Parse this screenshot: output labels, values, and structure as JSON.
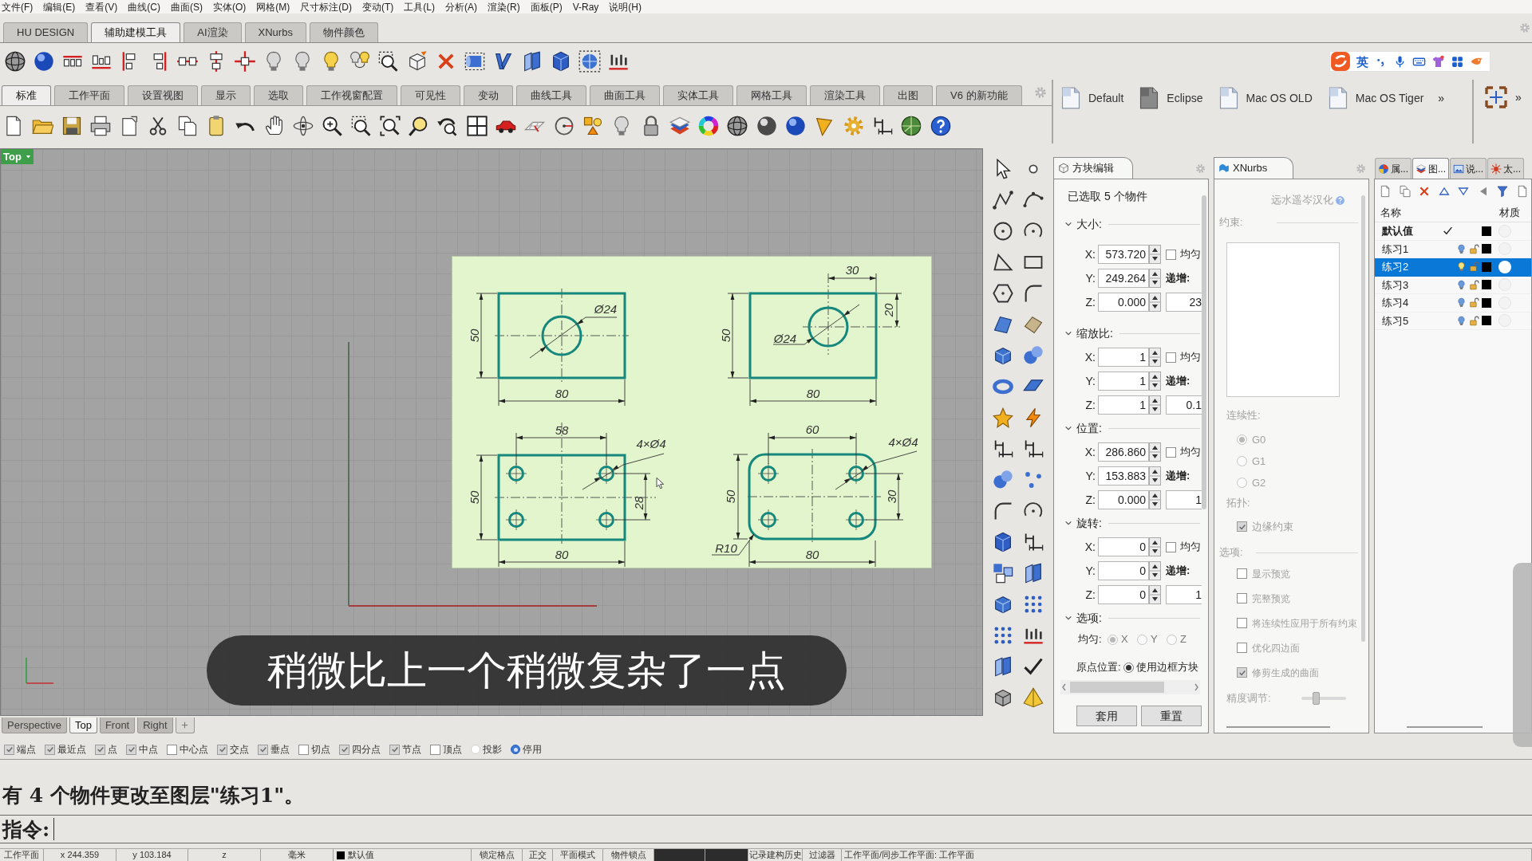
{
  "menu": [
    "文件(F)",
    "编辑(E)",
    "查看(V)",
    "曲线(C)",
    "曲面(S)",
    "实体(O)",
    "网格(M)",
    "尺寸标注(D)",
    "变动(T)",
    "工具(L)",
    "分析(A)",
    "渲染(R)",
    "面板(P)",
    "V-Ray",
    "说明(H)"
  ],
  "ribbon_tabs": [
    {
      "label": "HU DESIGN",
      "selected": false
    },
    {
      "label": "辅助建模工具",
      "selected": true
    },
    {
      "label": "AI渲染",
      "selected": false
    },
    {
      "label": "XNurbs",
      "selected": false
    },
    {
      "label": "物件颜色",
      "selected": false
    }
  ],
  "ime_bar": {
    "mode": "英"
  },
  "toolbar_tabs": [
    {
      "label": "标准",
      "selected": true
    },
    {
      "label": "工作平面",
      "selected": false
    },
    {
      "label": "设置视图",
      "selected": false
    },
    {
      "label": "显示",
      "selected": false
    },
    {
      "label": "选取",
      "selected": false
    },
    {
      "label": "工作视窗配置",
      "selected": false
    },
    {
      "label": "可见性",
      "selected": false
    },
    {
      "label": "变动",
      "selected": false
    },
    {
      "label": "曲线工具",
      "selected": false
    },
    {
      "label": "曲面工具",
      "selected": false
    },
    {
      "label": "实体工具",
      "selected": false
    },
    {
      "label": "网格工具",
      "selected": false
    },
    {
      "label": "渲染工具",
      "selected": false
    },
    {
      "label": "出图",
      "selected": false
    },
    {
      "label": "V6 的新功能",
      "selected": false
    }
  ],
  "skins": {
    "items": [
      {
        "label": "Default",
        "kind": "light"
      },
      {
        "label": "Eclipse",
        "kind": "dark"
      },
      {
        "label": "Mac OS OLD",
        "kind": "light"
      },
      {
        "label": "Mac OS Tiger",
        "kind": "light"
      }
    ],
    "more": "»"
  },
  "view_toolbar": {
    "more": "»"
  },
  "viewport": {
    "title": "Top",
    "subtitle": "稍微比上一个稍微复杂了一点",
    "tabs": [
      {
        "label": "Perspective",
        "selected": false
      },
      {
        "label": "Top",
        "selected": true
      },
      {
        "label": "Front",
        "selected": false
      },
      {
        "label": "Right",
        "selected": false
      }
    ]
  },
  "drawing": {
    "views": [
      {
        "kind": "centered-hole",
        "labels": [
          "50",
          "80",
          "Ø24"
        ]
      },
      {
        "kind": "offset-hole",
        "labels": [
          "30",
          "20",
          "50",
          "Ø24",
          "80"
        ]
      },
      {
        "kind": "four-holes",
        "labels": [
          "58",
          "4×Ø4",
          "50",
          "28",
          "80"
        ]
      },
      {
        "kind": "four-holes-rounded",
        "labels": [
          "60",
          "4×Ø4",
          "50",
          "30",
          "R10",
          "80"
        ]
      }
    ]
  },
  "block_edit": {
    "title": "方块编辑",
    "selection": "已选取 5 个物件",
    "sections": [
      {
        "title": "大小:",
        "expanded": true,
        "rows": [
          {
            "axis": "X:",
            "value": "573.720",
            "extra": {
              "kind": "checkbox",
              "label": "均匀",
              "checked": false
            }
          },
          {
            "axis": "Y:",
            "value": "249.264",
            "extra": {
              "kind": "label",
              "label": "递增:"
            }
          },
          {
            "axis": "Z:",
            "value": "0.000",
            "extra": {
              "kind": "field",
              "value": "23"
            }
          }
        ]
      },
      {
        "title": "缩放比:",
        "expanded": true,
        "rows": [
          {
            "axis": "X:",
            "value": "1",
            "extra": {
              "kind": "checkbox",
              "label": "均匀",
              "checked": false
            }
          },
          {
            "axis": "Y:",
            "value": "1",
            "extra": {
              "kind": "label",
              "label": "递增:"
            }
          },
          {
            "axis": "Z:",
            "value": "1",
            "extra": {
              "kind": "field",
              "value": "0.1"
            }
          }
        ]
      },
      {
        "title": "位置:",
        "expanded": true,
        "rows": [
          {
            "axis": "X:",
            "value": "286.860",
            "extra": {
              "kind": "checkbox",
              "label": "均匀",
              "checked": false
            }
          },
          {
            "axis": "Y:",
            "value": "153.883",
            "extra": {
              "kind": "label",
              "label": "递增:"
            }
          },
          {
            "axis": "Z:",
            "value": "0.000",
            "extra": {
              "kind": "field",
              "value": "1"
            }
          }
        ]
      },
      {
        "title": "旋转:",
        "expanded": true,
        "rows": [
          {
            "axis": "X:",
            "value": "0",
            "extra": {
              "kind": "checkbox",
              "label": "均匀",
              "checked": false
            }
          },
          {
            "axis": "Y:",
            "value": "0",
            "extra": {
              "kind": "label",
              "label": "递增:"
            }
          },
          {
            "axis": "Z:",
            "value": "0",
            "extra": {
              "kind": "field",
              "value": "1"
            }
          }
        ]
      }
    ],
    "options": {
      "title": "选项:",
      "expanded": true,
      "uniform_label": "均匀:",
      "uniform_axes": [
        {
          "label": "X",
          "selected": true
        },
        {
          "label": "Y",
          "selected": false
        },
        {
          "label": "Z",
          "selected": false
        }
      ],
      "origin_label": "原点位置:",
      "origin_choices": [
        {
          "label": "使用边框方块",
          "selected": true
        }
      ]
    },
    "buttons": [
      "套用",
      "重置"
    ]
  },
  "xnurbs": {
    "title": "XNurbs",
    "credit": "远水遥岑汉化",
    "constraints_label": "约束:",
    "continuity_label": "连续性:",
    "continuity": [
      {
        "label": "G0",
        "selected": true
      },
      {
        "label": "G1",
        "selected": false
      },
      {
        "label": "G2",
        "selected": false
      }
    ],
    "topology_label": "拓扑:",
    "topology": [
      {
        "label": "边缘约束",
        "checked": true
      }
    ],
    "options_label": "选项:",
    "options": [
      {
        "label": "显示预览",
        "checked": false
      },
      {
        "label": "完整预览",
        "checked": false
      },
      {
        "label": "将连续性应用于所有约束",
        "checked": false
      },
      {
        "label": "优化四边面",
        "checked": false
      },
      {
        "label": "修剪生成的曲面",
        "checked": true
      }
    ],
    "precision_label": "精度调节:",
    "precision": {
      "level": 0.3
    }
  },
  "layers": {
    "tabs": [
      {
        "label": "属...",
        "selected": false
      },
      {
        "label": "图...",
        "selected": true
      },
      {
        "label": "说...",
        "selected": false
      },
      {
        "label": "太...",
        "selected": false
      }
    ],
    "columns": [
      "名称",
      "材质"
    ],
    "rows": [
      {
        "name": "默认值",
        "current": true,
        "selected": false,
        "color": "#000000"
      },
      {
        "name": "练习1",
        "current": false,
        "selected": false,
        "color": "#000000"
      },
      {
        "name": "练习2",
        "current": false,
        "selected": true,
        "color": "#000000"
      },
      {
        "name": "练习3",
        "current": false,
        "selected": false,
        "color": "#000000"
      },
      {
        "name": "练习4",
        "current": false,
        "selected": false,
        "color": "#000000"
      },
      {
        "name": "练习5",
        "current": false,
        "selected": false,
        "color": "#000000"
      }
    ]
  },
  "osnaps": [
    {
      "label": "端点",
      "kind": "box",
      "checked": true
    },
    {
      "label": "最近点",
      "kind": "box",
      "checked": true
    },
    {
      "label": "点",
      "kind": "box",
      "checked": true
    },
    {
      "label": "中点",
      "kind": "box",
      "checked": true
    },
    {
      "label": "中心点",
      "kind": "box",
      "checked": false
    },
    {
      "label": "交点",
      "kind": "box",
      "checked": true
    },
    {
      "label": "垂点",
      "kind": "box",
      "checked": true
    },
    {
      "label": "切点",
      "kind": "box",
      "checked": false
    },
    {
      "label": "四分点",
      "kind": "box",
      "checked": true
    },
    {
      "label": "节点",
      "kind": "box",
      "checked": true
    },
    {
      "label": "顶点",
      "kind": "box",
      "checked": false
    },
    {
      "label": "投影",
      "kind": "round",
      "checked": false
    },
    {
      "label": "停用",
      "kind": "round",
      "checked": true
    }
  ],
  "history": [
    "有 4 个物件更改至图层\"练习1\"。"
  ],
  "command": {
    "prompt": "指令:"
  },
  "status_bar": [
    {
      "kind": "text",
      "text": "工作平面"
    },
    {
      "kind": "text",
      "text": "x 244.359"
    },
    {
      "kind": "text",
      "text": "y 103.184"
    },
    {
      "kind": "text",
      "text": "z"
    },
    {
      "kind": "text",
      "text": "毫米"
    },
    {
      "kind": "layer",
      "text": "默认值",
      "color": "#000000"
    },
    {
      "kind": "toggle",
      "text": "锁定格点",
      "on": false
    },
    {
      "kind": "toggle",
      "text": "正交",
      "on": false
    },
    {
      "kind": "toggle",
      "text": "平面模式",
      "on": false
    },
    {
      "kind": "toggle",
      "text": "物件锁点",
      "on": false
    },
    {
      "kind": "indicator",
      "on": true
    },
    {
      "kind": "indicator",
      "on": true
    },
    {
      "kind": "toggle",
      "text": "记录建构历史",
      "on": false
    },
    {
      "kind": "text",
      "text": "过滤器"
    },
    {
      "kind": "text",
      "text": "工作平面/同步工作平面: 工作平面"
    }
  ]
}
